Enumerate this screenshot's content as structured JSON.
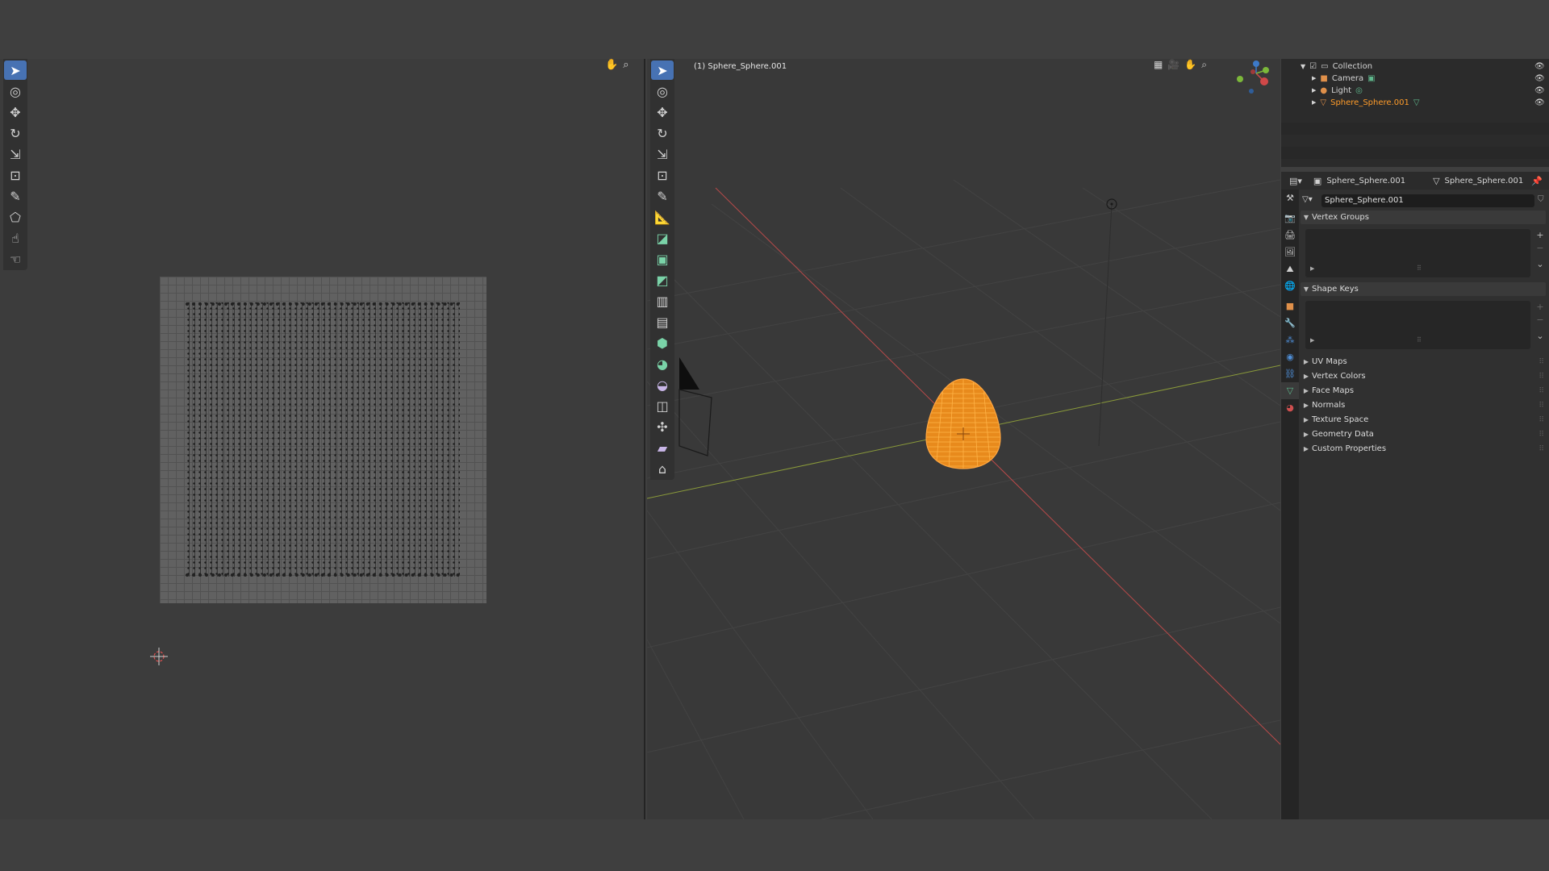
{
  "viewport": {
    "title": "(1) Sphere_Sphere.001"
  },
  "outliner": {
    "items": [
      {
        "label": "Collection",
        "icon": "collection-icon"
      },
      {
        "label": "Camera",
        "icon": "camera-icon"
      },
      {
        "label": "Light",
        "icon": "light-icon"
      },
      {
        "label": "Sphere_Sphere.001",
        "icon": "mesh-object-icon"
      }
    ]
  },
  "properties": {
    "object_name": "Sphere_Sphere.001",
    "mesh_name": "Sphere_Sphere.001",
    "data_field": "Sphere_Sphere.001",
    "panels": {
      "vertex_groups": "Vertex Groups",
      "shape_keys": "Shape Keys"
    },
    "collapsed_panels": [
      "UV Maps",
      "Vertex Colors",
      "Face Maps",
      "Normals",
      "Texture Space",
      "Geometry Data",
      "Custom Properties"
    ]
  },
  "colors": {
    "selection": "#ff9c2a",
    "accent": "#4772b3",
    "axis_x": "#b94a4a",
    "axis_y": "#8a9a3a"
  }
}
